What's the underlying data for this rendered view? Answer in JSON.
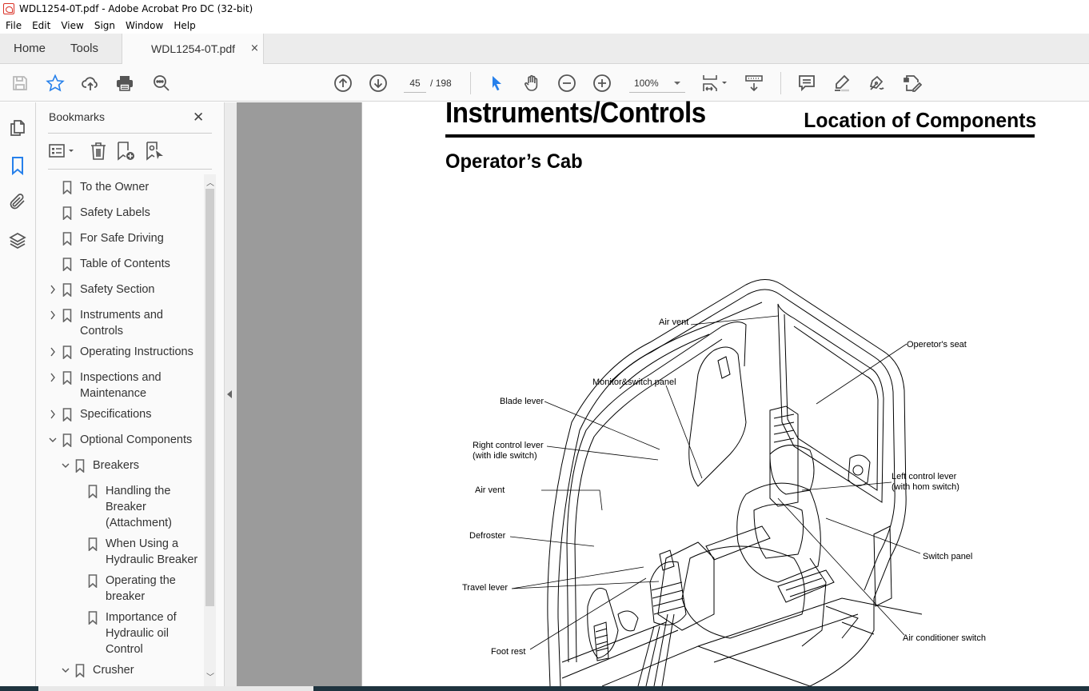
{
  "window": {
    "title": "WDL1254-0T.pdf - Adobe Acrobat Pro DC (32-bit)"
  },
  "menu": [
    "File",
    "Edit",
    "View",
    "Sign",
    "Window",
    "Help"
  ],
  "tabs": {
    "home": "Home",
    "tools": "Tools",
    "document": "WDL1254-0T.pdf",
    "close_glyph": "×"
  },
  "toolbar": {
    "icons": [
      "save-icon",
      "bookmark-star-icon",
      "upload-cloud-icon",
      "print-icon",
      "find-icon",
      "previous-page-icon",
      "next-page-icon",
      "select-arrow-icon",
      "hand-icon",
      "zoom-out-icon",
      "zoom-in-icon",
      "fit-page-icon",
      "scroll-mode-icon",
      "comment-icon",
      "highlight-icon",
      "sign-icon",
      "edit-pdf-icon"
    ],
    "current_page": "45",
    "page_separator": "/",
    "total_pages": "198",
    "zoom": "100%",
    "accent_color": "#2680eb"
  },
  "left_rail": {
    "icons": [
      "page-thumbnails-icon",
      "bookmarks-icon",
      "attachments-icon",
      "layers-icon"
    ],
    "active": "bookmarks-icon"
  },
  "bookmarks": {
    "title": "Bookmarks",
    "close_glyph": "✕",
    "tools": [
      "options-menu-icon",
      "delete-bookmark-icon",
      "new-bookmark-icon",
      "new-bookmark-from-structure-icon"
    ],
    "items": [
      {
        "label": "To the Owner",
        "level": 0,
        "expander": "none"
      },
      {
        "label": "Safety Labels",
        "level": 0,
        "expander": "none"
      },
      {
        "label": "For Safe Driving",
        "level": 0,
        "expander": "none"
      },
      {
        "label": "Table of Contents",
        "level": 0,
        "expander": "none"
      },
      {
        "label": "Safety Section",
        "level": 0,
        "expander": "collapsed"
      },
      {
        "label": "Instruments and Controls",
        "level": 0,
        "expander": "collapsed"
      },
      {
        "label": "Operating Instructions",
        "level": 0,
        "expander": "collapsed"
      },
      {
        "label": "Inspections and Maintenance",
        "level": 0,
        "expander": "collapsed"
      },
      {
        "label": "Specifications",
        "level": 0,
        "expander": "collapsed"
      },
      {
        "label": "Optional Components",
        "level": 0,
        "expander": "expanded"
      },
      {
        "label": "Breakers",
        "level": 1,
        "expander": "expanded"
      },
      {
        "label": "Handling the Breaker (Attachment)",
        "level": 2,
        "expander": "none"
      },
      {
        "label": "When Using a Hydraulic Breaker",
        "level": 2,
        "expander": "none"
      },
      {
        "label": "Operating the breaker",
        "level": 2,
        "expander": "none"
      },
      {
        "label": "Importance of Hydraulic oil Control",
        "level": 2,
        "expander": "none"
      },
      {
        "label": "Crusher",
        "level": 1,
        "expander": "expanded"
      }
    ]
  },
  "document": {
    "section_title": "Instruments/Controls",
    "header_right": "Location of Components",
    "subtitle": "Operator’s Cab",
    "figure_labels": {
      "air_vent_top": "Air vent",
      "operator_seat": "Operetor's seat",
      "monitor_switch_panel": "Monitor&switch panel",
      "blade_lever": "Blade lever",
      "right_control_lever_1": "Right control lever",
      "right_control_lever_2": "(with idle switch)",
      "air_vent_left": "Air vent",
      "left_control_lever_1": "Left control lever",
      "left_control_lever_2": "(with hom switch)",
      "defroster": "Defroster",
      "switch_panel": "Switch panel",
      "travel_lever": "Travel lever",
      "air_conditioner_switch": "Air conditioner switch",
      "foot_rest": "Foot rest"
    }
  }
}
